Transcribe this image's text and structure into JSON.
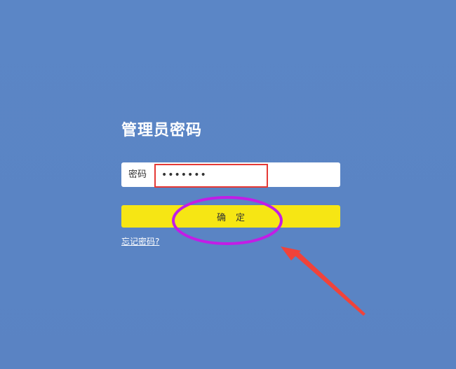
{
  "login": {
    "title": "管理员密码",
    "password_label": "密码",
    "password_value": "•••••••",
    "confirm_label": "确定",
    "forgot_label": "忘记密码?"
  },
  "colors": {
    "background": "#5a84c4",
    "confirm_button": "#f6e614",
    "input_highlight": "#e53935",
    "ellipse_annotation": "#c21de6",
    "arrow_annotation": "#f0433a"
  }
}
